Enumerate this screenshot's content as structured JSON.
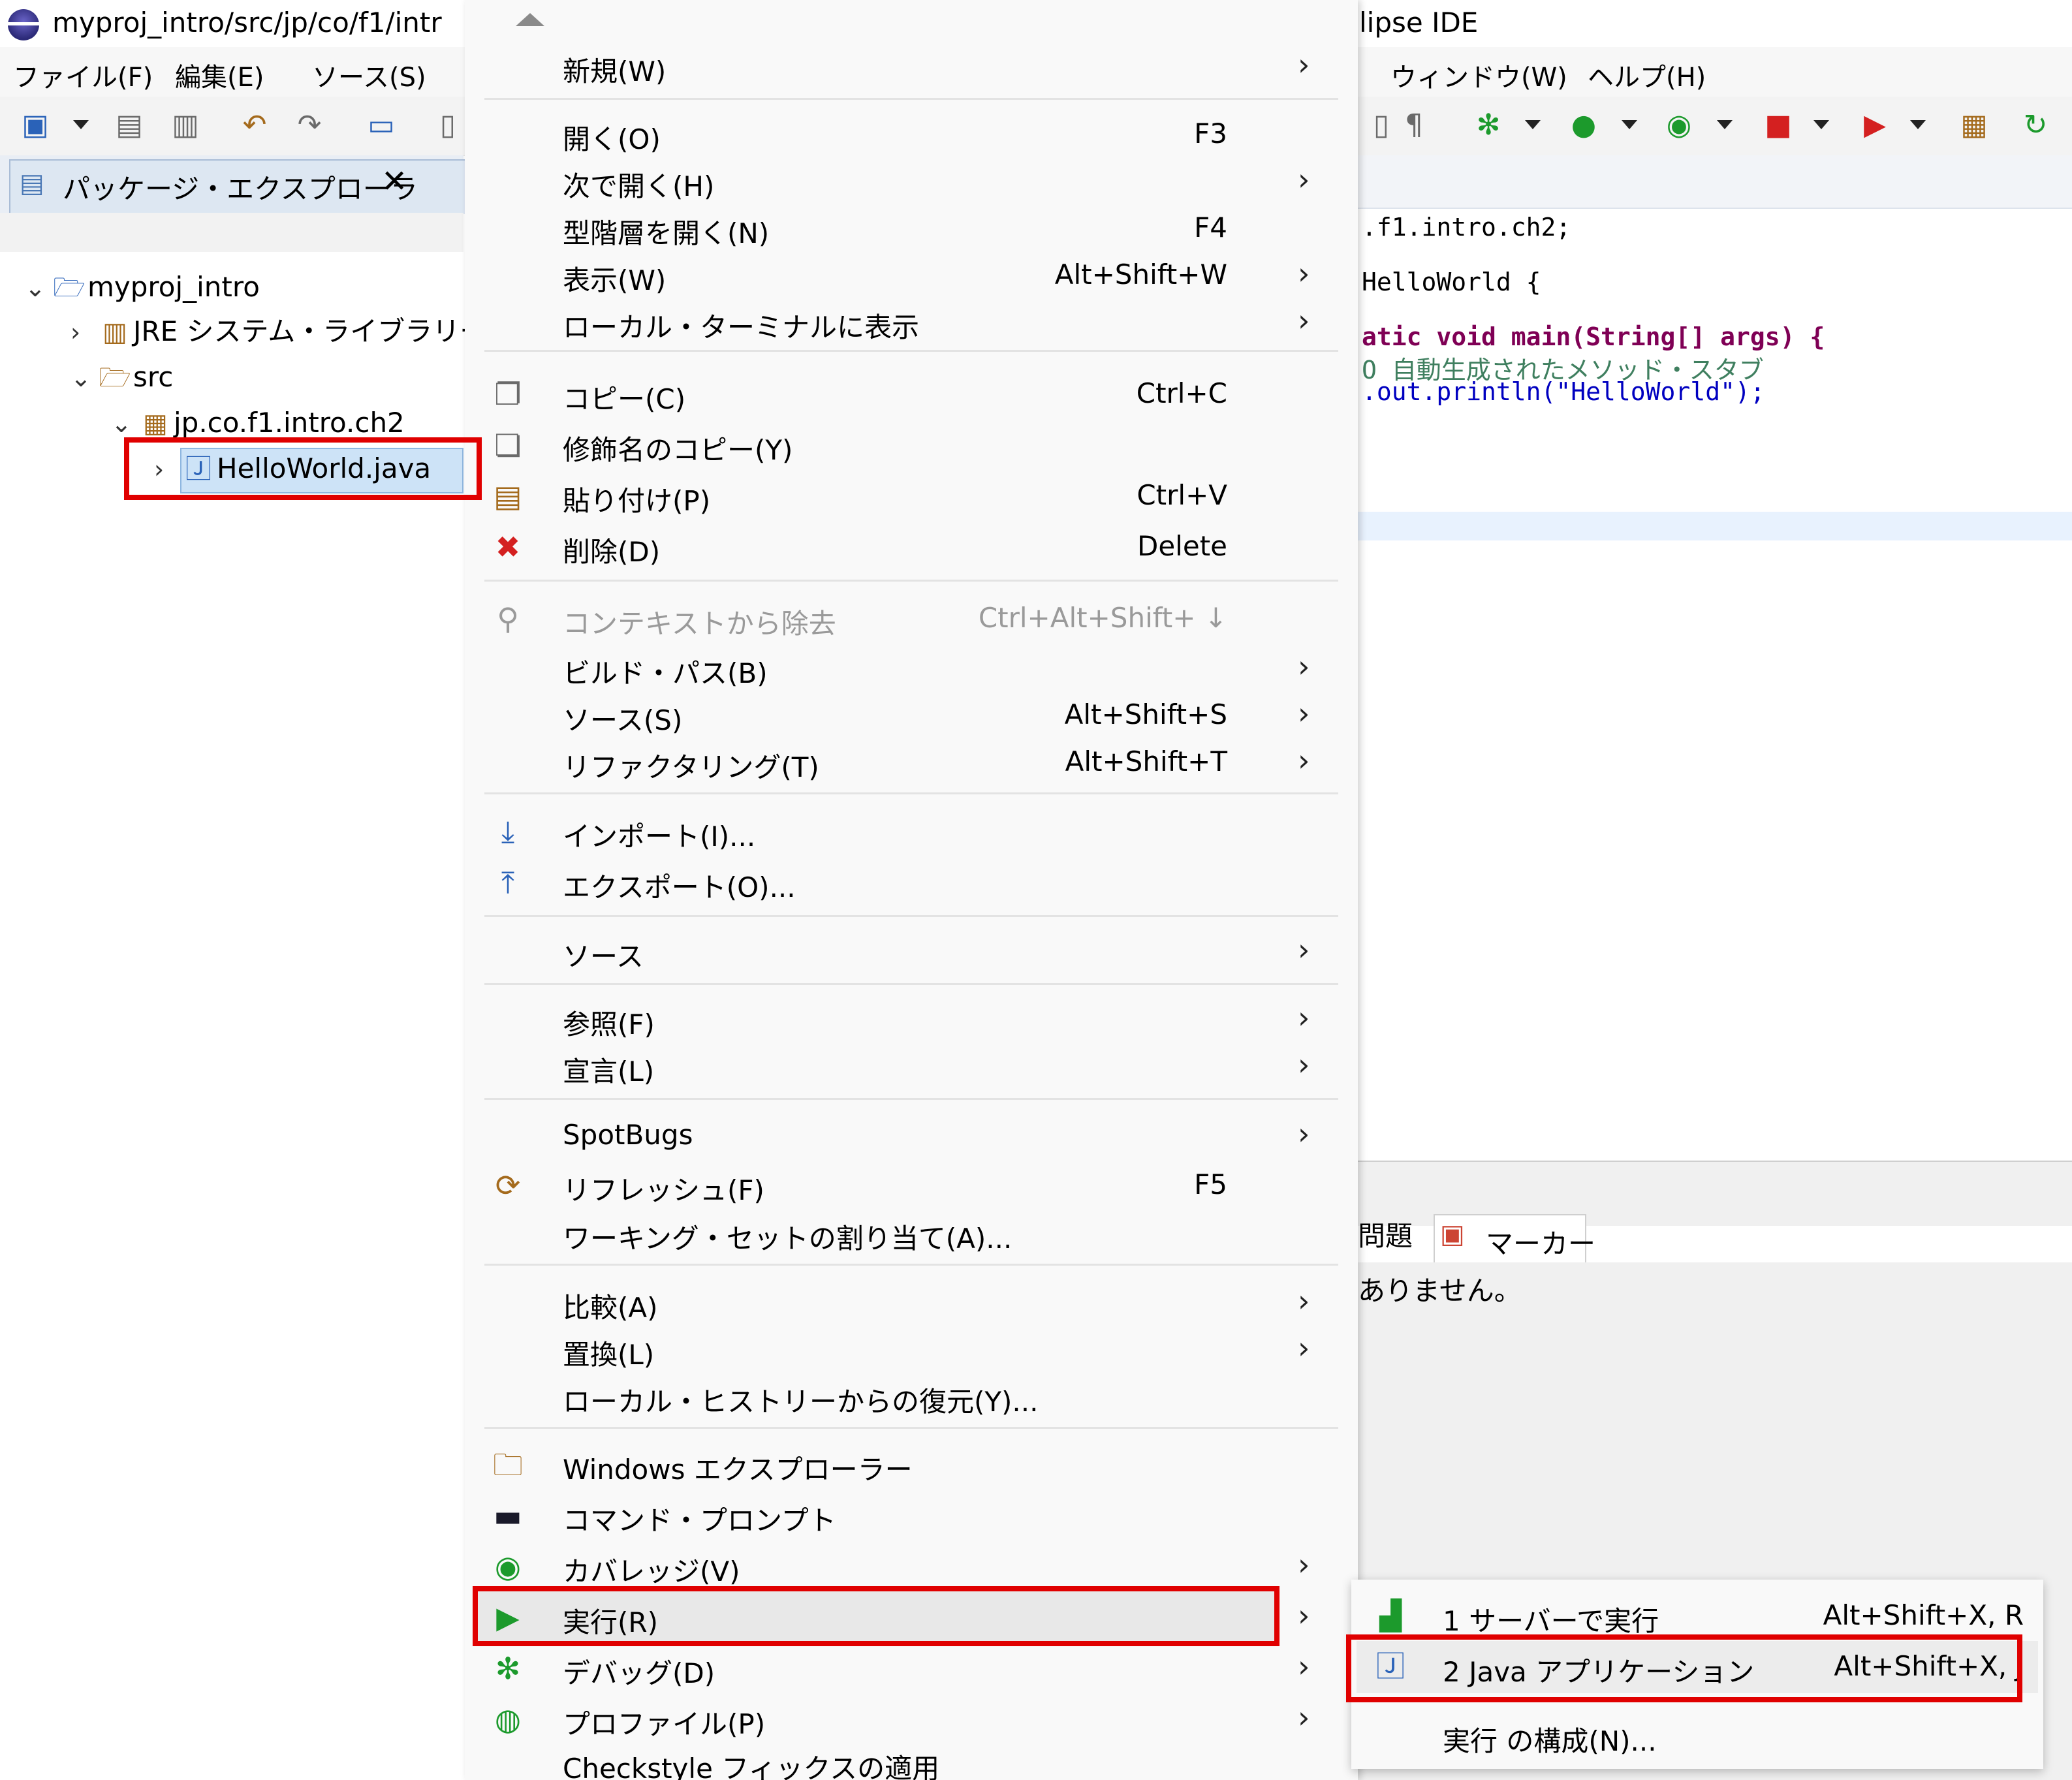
{
  "window": {
    "title_left": "myproj_intro/src/jp/co/f1/intr",
    "title_right": "lipse IDE"
  },
  "menubar": {
    "file": "ファイル(F)",
    "edit": "編集(E)",
    "source": "ソース(S)",
    "window": "ウィンドウ(W)",
    "help": "ヘルプ(H)"
  },
  "package_explorer": {
    "tab_label": "パッケージ・エクスプローラ",
    "tree": [
      {
        "label": "myproj_intro",
        "twisty": "⌄"
      },
      {
        "label": "JRE システム・ライブラリー",
        "twisty": "›"
      },
      {
        "label": "src",
        "twisty": "⌄"
      },
      {
        "label": "jp.co.f1.intro.ch2",
        "twisty": "⌄"
      },
      {
        "label": "HelloWorld.java",
        "twisty": "›"
      }
    ]
  },
  "editor": {
    "lines": [
      ".f1.intro.ch2;",
      "HelloWorld {",
      "atic void main(String[] args) {",
      "O 自動生成されたメソッド・スタブ",
      ".out.println(\"HelloWorld\");"
    ]
  },
  "bottom_panel": {
    "problems_tab": "問題",
    "markers_tab": "マーカー",
    "message": "ありません。"
  },
  "context_menu": {
    "items": [
      {
        "label": "新規(W)",
        "accel": "",
        "submenu": true
      },
      {
        "label": "開く(O)",
        "accel": "F3",
        "submenu": false
      },
      {
        "label": "次で開く(H)",
        "accel": "",
        "submenu": true
      },
      {
        "label": "型階層を開く(N)",
        "accel": "F4",
        "submenu": false
      },
      {
        "label": "表示(W)",
        "accel": "Alt+Shift+W",
        "submenu": true
      },
      {
        "label": "ローカル・ターミナルに表示",
        "accel": "",
        "submenu": true
      },
      {
        "label": "コピー(C)",
        "accel": "Ctrl+C",
        "submenu": false
      },
      {
        "label": "修飾名のコピー(Y)",
        "accel": "",
        "submenu": false
      },
      {
        "label": "貼り付け(P)",
        "accel": "Ctrl+V",
        "submenu": false
      },
      {
        "label": "削除(D)",
        "accel": "Delete",
        "submenu": false
      },
      {
        "label": "コンテキストから除去",
        "accel": "Ctrl+Alt+Shift+ ↓",
        "submenu": false,
        "disabled": true
      },
      {
        "label": "ビルド・パス(B)",
        "accel": "",
        "submenu": true
      },
      {
        "label": "ソース(S)",
        "accel": "Alt+Shift+S",
        "submenu": true
      },
      {
        "label": "リファクタリング(T)",
        "accel": "Alt+Shift+T",
        "submenu": true
      },
      {
        "label": "インポート(I)...",
        "accel": "",
        "submenu": false
      },
      {
        "label": "エクスポート(O)...",
        "accel": "",
        "submenu": false
      },
      {
        "label": "ソース",
        "accel": "",
        "submenu": true
      },
      {
        "label": "参照(F)",
        "accel": "",
        "submenu": true
      },
      {
        "label": "宣言(L)",
        "accel": "",
        "submenu": true
      },
      {
        "label": "SpotBugs",
        "accel": "",
        "submenu": true
      },
      {
        "label": "リフレッシュ(F)",
        "accel": "F5",
        "submenu": false
      },
      {
        "label": "ワーキング・セットの割り当て(A)...",
        "accel": "",
        "submenu": false
      },
      {
        "label": "比較(A)",
        "accel": "",
        "submenu": true
      },
      {
        "label": "置換(L)",
        "accel": "",
        "submenu": true
      },
      {
        "label": "ローカル・ヒストリーからの復元(Y)...",
        "accel": "",
        "submenu": false
      },
      {
        "label": "Windows エクスプローラー",
        "accel": "",
        "submenu": false
      },
      {
        "label": "コマンド・プロンプト",
        "accel": "",
        "submenu": false
      },
      {
        "label": "カバレッジ(V)",
        "accel": "",
        "submenu": true
      },
      {
        "label": "実行(R)",
        "accel": "",
        "submenu": true
      },
      {
        "label": "デバッグ(D)",
        "accel": "",
        "submenu": true
      },
      {
        "label": "プロファイル(P)",
        "accel": "",
        "submenu": true
      },
      {
        "label": "Checkstyle フィックスの適用",
        "accel": "",
        "submenu": false
      }
    ]
  },
  "run_submenu": {
    "items": [
      {
        "label": "1 サーバーで実行",
        "accel": "Alt+Shift+X, R"
      },
      {
        "label": "2 Java アプリケーション",
        "accel": "Alt+Shift+X, J"
      },
      {
        "label": "実行 の構成(N)...",
        "accel": ""
      }
    ]
  },
  "glyphs": {
    "submenu_arrow": "›",
    "close": "✕"
  },
  "colors": {
    "highlight_red": "#e00000",
    "selection_blue": "#cde3f7"
  }
}
